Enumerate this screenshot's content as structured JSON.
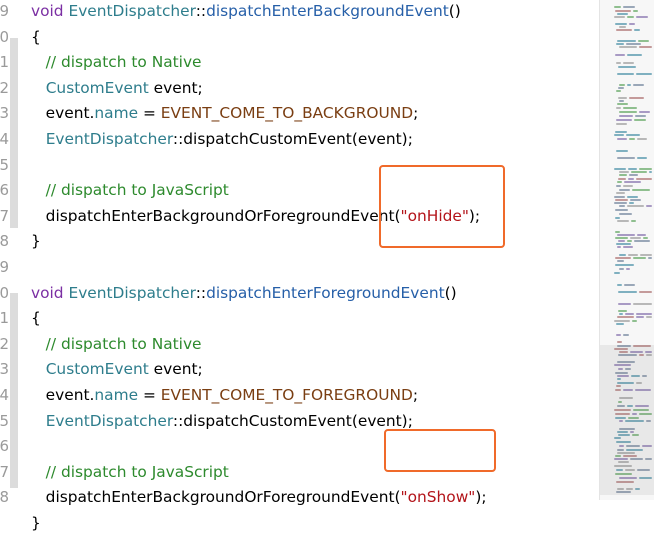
{
  "gutter": {
    "line_numbers": [
      {
        "n": "9",
        "line": 0
      },
      {
        "n": "0",
        "line": 1
      },
      {
        "n": "1",
        "line": 2
      },
      {
        "n": "2",
        "line": 3
      },
      {
        "n": "3",
        "line": 4
      },
      {
        "n": "4",
        "line": 5
      },
      {
        "n": "5",
        "line": 6
      },
      {
        "n": "6",
        "line": 7
      },
      {
        "n": "7",
        "line": 8
      },
      {
        "n": "8",
        "line": 9
      },
      {
        "n": "9",
        "line": 10
      },
      {
        "n": "0",
        "line": 11
      },
      {
        "n": "1",
        "line": 12
      },
      {
        "n": "2",
        "line": 13
      },
      {
        "n": "3",
        "line": 14
      },
      {
        "n": "4",
        "line": 15
      },
      {
        "n": "5",
        "line": 16
      },
      {
        "n": "6",
        "line": 17
      },
      {
        "n": "7",
        "line": 18
      },
      {
        "n": "8",
        "line": 19
      }
    ]
  },
  "code": {
    "lines": [
      [
        {
          "t": "void ",
          "c": "kw"
        },
        {
          "t": "EventDispatcher",
          "c": "cls"
        },
        {
          "t": "::",
          "c": ""
        },
        {
          "t": "dispatchEnterBackgroundEvent",
          "c": "fn"
        },
        {
          "t": "()",
          "c": ""
        }
      ],
      [
        {
          "t": "{",
          "c": ""
        }
      ],
      [
        {
          "t": "   // dispatch to Native",
          "c": "cmt"
        }
      ],
      [
        {
          "t": "   ",
          "c": ""
        },
        {
          "t": "CustomEvent",
          "c": "cls"
        },
        {
          "t": " event;",
          "c": ""
        }
      ],
      [
        {
          "t": "   event.",
          "c": ""
        },
        {
          "t": "name",
          "c": "mem"
        },
        {
          "t": " = ",
          "c": ""
        },
        {
          "t": "EVENT_COME_TO_BACKGROUND",
          "c": "macro"
        },
        {
          "t": ";",
          "c": ""
        }
      ],
      [
        {
          "t": "   ",
          "c": ""
        },
        {
          "t": "EventDispatcher",
          "c": "cls"
        },
        {
          "t": "::dispatchCustomEvent(event);",
          "c": ""
        }
      ],
      [
        {
          "t": "",
          "c": ""
        }
      ],
      [
        {
          "t": "   // dispatch to JavaScript",
          "c": "cmt"
        }
      ],
      [
        {
          "t": "   dispatchEnterBackgroundOrForegroundEvent(",
          "c": ""
        },
        {
          "t": "\"onHide\"",
          "c": "str"
        },
        {
          "t": ");",
          "c": ""
        }
      ],
      [
        {
          "t": "}",
          "c": ""
        }
      ],
      [
        {
          "t": "",
          "c": ""
        }
      ],
      [
        {
          "t": "void ",
          "c": "kw"
        },
        {
          "t": "EventDispatcher",
          "c": "cls"
        },
        {
          "t": "::",
          "c": ""
        },
        {
          "t": "dispatchEnterForegroundEvent",
          "c": "fn"
        },
        {
          "t": "()",
          "c": ""
        }
      ],
      [
        {
          "t": "{",
          "c": ""
        }
      ],
      [
        {
          "t": "   // dispatch to Native",
          "c": "cmt"
        }
      ],
      [
        {
          "t": "   ",
          "c": ""
        },
        {
          "t": "CustomEvent",
          "c": "cls"
        },
        {
          "t": " event;",
          "c": ""
        }
      ],
      [
        {
          "t": "   event.",
          "c": ""
        },
        {
          "t": "name",
          "c": "mem"
        },
        {
          "t": " = ",
          "c": ""
        },
        {
          "t": "EVENT_COME_TO_FOREGROUND",
          "c": "macro"
        },
        {
          "t": ";",
          "c": ""
        }
      ],
      [
        {
          "t": "   ",
          "c": ""
        },
        {
          "t": "EventDispatcher",
          "c": "cls"
        },
        {
          "t": "::dispatchCustomEvent(event);",
          "c": ""
        }
      ],
      [
        {
          "t": "",
          "c": ""
        }
      ],
      [
        {
          "t": "   // dispatch to JavaScript",
          "c": "cmt"
        }
      ],
      [
        {
          "t": "   dispatchEnterBackgroundOrForegroundEvent(",
          "c": ""
        },
        {
          "t": "\"onShow\"",
          "c": "str"
        },
        {
          "t": ");",
          "c": ""
        }
      ],
      [
        {
          "t": "}",
          "c": ""
        }
      ]
    ]
  },
  "colors": {
    "highlight_box": "#f06a2a",
    "keyword": "#7b2fa3",
    "type": "#2e7d8c",
    "function": "#265fa8",
    "string": "#b3141a",
    "comment": "#2d8a2d",
    "macro": "#7a3e12"
  }
}
